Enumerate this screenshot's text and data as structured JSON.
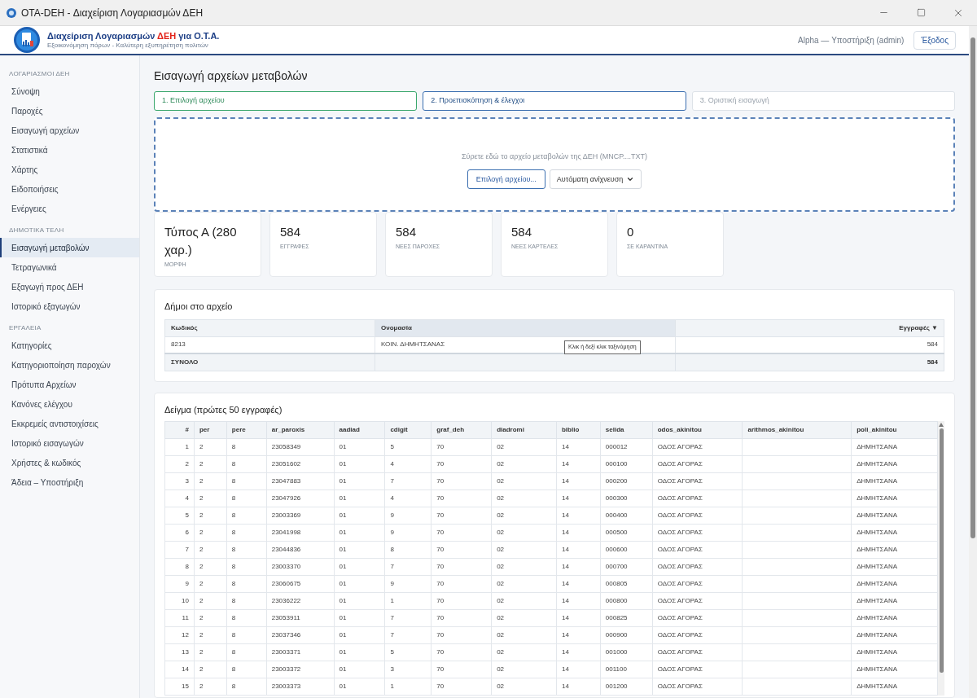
{
  "window": {
    "title": "OTA-DEH - Διαχείριση Λογαριασμών ΔΕΗ"
  },
  "header": {
    "brand_start": "Διαχείριση Λογαριασμών",
    "brand_accent": "ΔΕΗ",
    "brand_end": "για Ο.Τ.Α.",
    "tagline": "Εξοικονόμηση πόρων - Καλύτερη εξυπηρέτηση πολιτών",
    "user": "Alpha — Υποστήριξη (admin)",
    "logout": "Έξοδος"
  },
  "sidebar": [
    {
      "heading": "ΛΟΓΑΡΙΑΣΜΟΙ ΔΕΗ",
      "items": [
        {
          "label": "Σύνοψη",
          "selected": false
        },
        {
          "label": "Παροχές",
          "selected": false
        },
        {
          "label": "Εισαγωγή αρχείων",
          "selected": false
        },
        {
          "label": "Στατιστικά",
          "selected": false
        },
        {
          "label": "Χάρτης",
          "selected": false
        },
        {
          "label": "Ειδοποιήσεις",
          "selected": false
        },
        {
          "label": "Ενέργειες",
          "selected": false
        }
      ]
    },
    {
      "heading": "ΔΗΜΟΤΙΚΑ ΤΕΛΗ",
      "items": [
        {
          "label": "Εισαγωγή μεταβολών",
          "selected": true
        },
        {
          "label": "Τετραγωνικά",
          "selected": false
        },
        {
          "label": "Εξαγωγή προς ΔΕΗ",
          "selected": false
        },
        {
          "label": "Ιστορικό εξαγωγών",
          "selected": false
        }
      ]
    },
    {
      "heading": "ΕΡΓΑΛΕΙΑ",
      "items": [
        {
          "label": "Κατηγορίες",
          "selected": false
        },
        {
          "label": "Κατηγοριοποίηση παροχών",
          "selected": false
        },
        {
          "label": "Πρότυπα Αρχείων",
          "selected": false
        },
        {
          "label": "Κανόνες ελέγχου",
          "selected": false
        },
        {
          "label": "Εκκρεμείς αντιστοιχίσεις",
          "selected": false
        },
        {
          "label": "Ιστορικό εισαγωγών",
          "selected": false
        },
        {
          "label": "Χρήστες & κωδικός",
          "selected": false
        },
        {
          "label": "Άδεια – Υποστήριξη",
          "selected": false
        }
      ]
    }
  ],
  "page_title": "Εισαγωγή αρχείων μεταβολών",
  "steps": [
    {
      "label": "1. Επιλογή αρχείου",
      "kind": "done"
    },
    {
      "label": "2. Προεπισκόπηση & έλεγχοι",
      "kind": "active"
    },
    {
      "label": "3. Οριστική εισαγωγή",
      "kind": "pending"
    }
  ],
  "dropzone": {
    "hint": "Σύρετε εδώ το αρχείο μεταβολών της ΔΕΗ (MNCP....TXT)",
    "button": "Επιλογή αρχείου...",
    "format_select": "Αυτόματη ανίχνευση"
  },
  "stats": [
    {
      "value": "Τύπος Α (280 χαρ.)",
      "label": "ΜΟΡΦΗ"
    },
    {
      "value": "584",
      "label": "ΕΓΓΡΑΦΕΣ"
    },
    {
      "value": "584",
      "label": "ΝΕΕΣ ΠΑΡΟΧΕΣ"
    },
    {
      "value": "584",
      "label": "ΝΕΕΣ ΚΑΡΤΕΛΕΣ"
    },
    {
      "value": "0",
      "label": "ΣΕ ΚΑΡΑΝΤΙΝΑ"
    }
  ],
  "municipalities": {
    "title": "Δήμοι στο αρχείο",
    "columns": [
      {
        "label": "Κωδικός",
        "hovered": false
      },
      {
        "label": "Ονομασία",
        "hovered": true
      },
      {
        "label": "Εγγραφές",
        "hovered": false,
        "sort": "▼"
      }
    ],
    "rows": [
      [
        "8213",
        "ΚΟΙΝ. ΔΗΜΗΤΣΑΝΑΣ",
        "584"
      ]
    ],
    "total": {
      "label": "ΣΥΝΟΛΟ",
      "count": "584"
    },
    "tooltip": "Κλικ ή δεξί κλικ ταξινόμηση"
  },
  "sample": {
    "title": "Δείγμα (πρώτες 50 εγγραφές)",
    "columns": [
      "#",
      "per",
      "pere",
      "ar_paroxis",
      "aadiad",
      "cdigit",
      "graf_deh",
      "diadromi",
      "biblio",
      "selida",
      "odos_akinitou",
      "arithmos_akinitou",
      "poli_akinitou"
    ],
    "rows": [
      [
        "1",
        "2",
        "8",
        "23058349",
        "01",
        "5",
        "70",
        "02",
        "14",
        "000012",
        "ΟΔΟΣ ΑΓΟΡΑΣ",
        null,
        "ΔΗΜΗΤΣΑΝΑ"
      ],
      [
        "2",
        "2",
        "8",
        "23051602",
        "01",
        "4",
        "70",
        "02",
        "14",
        "000100",
        "ΟΔΟΣ ΑΓΟΡΑΣ",
        null,
        "ΔΗΜΗΤΣΑΝΑ"
      ],
      [
        "3",
        "2",
        "8",
        "23047883",
        "01",
        "7",
        "70",
        "02",
        "14",
        "000200",
        "ΟΔΟΣ ΑΓΟΡΑΣ",
        null,
        "ΔΗΜΗΤΣΑΝΑ"
      ],
      [
        "4",
        "2",
        "8",
        "23047926",
        "01",
        "4",
        "70",
        "02",
        "14",
        "000300",
        "ΟΔΟΣ ΑΓΟΡΑΣ",
        null,
        "ΔΗΜΗΤΣΑΝΑ"
      ],
      [
        "5",
        "2",
        "8",
        "23003369",
        "01",
        "9",
        "70",
        "02",
        "14",
        "000400",
        "ΟΔΟΣ ΑΓΟΡΑΣ",
        null,
        "ΔΗΜΗΤΣΑΝΑ"
      ],
      [
        "6",
        "2",
        "8",
        "23041998",
        "01",
        "9",
        "70",
        "02",
        "14",
        "000500",
        "ΟΔΟΣ ΑΓΟΡΑΣ",
        null,
        "ΔΗΜΗΤΣΑΝΑ"
      ],
      [
        "7",
        "2",
        "8",
        "23044836",
        "01",
        "8",
        "70",
        "02",
        "14",
        "000600",
        "ΟΔΟΣ ΑΓΟΡΑΣ",
        null,
        "ΔΗΜΗΤΣΑΝΑ"
      ],
      [
        "8",
        "2",
        "8",
        "23003370",
        "01",
        "7",
        "70",
        "02",
        "14",
        "000700",
        "ΟΔΟΣ ΑΓΟΡΑΣ",
        null,
        "ΔΗΜΗΤΣΑΝΑ"
      ],
      [
        "9",
        "2",
        "8",
        "23060675",
        "01",
        "9",
        "70",
        "02",
        "14",
        "000805",
        "ΟΔΟΣ ΑΓΟΡΑΣ",
        null,
        "ΔΗΜΗΤΣΑΝΑ"
      ],
      [
        "10",
        "2",
        "8",
        "23036222",
        "01",
        "1",
        "70",
        "02",
        "14",
        "000800",
        "ΟΔΟΣ ΑΓΟΡΑΣ",
        null,
        "ΔΗΜΗΤΣΑΝΑ"
      ],
      [
        "11",
        "2",
        "8",
        "23053911",
        "01",
        "7",
        "70",
        "02",
        "14",
        "000825",
        "ΟΔΟΣ ΑΓΟΡΑΣ",
        null,
        "ΔΗΜΗΤΣΑΝΑ"
      ],
      [
        "12",
        "2",
        "8",
        "23037346",
        "01",
        "7",
        "70",
        "02",
        "14",
        "000900",
        "ΟΔΟΣ ΑΓΟΡΑΣ",
        null,
        "ΔΗΜΗΤΣΑΝΑ"
      ],
      [
        "13",
        "2",
        "8",
        "23003371",
        "01",
        "5",
        "70",
        "02",
        "14",
        "001000",
        "ΟΔΟΣ ΑΓΟΡΑΣ",
        null,
        "ΔΗΜΗΤΣΑΝΑ"
      ],
      [
        "14",
        "2",
        "8",
        "23003372",
        "01",
        "3",
        "70",
        "02",
        "14",
        "001100",
        "ΟΔΟΣ ΑΓΟΡΑΣ",
        null,
        "ΔΗΜΗΤΣΑΝΑ"
      ],
      [
        "15",
        "2",
        "8",
        "23003373",
        "01",
        "1",
        "70",
        "02",
        "14",
        "001200",
        "ΟΔΟΣ ΑΓΟΡΑΣ",
        null,
        "ΔΗΜΗΤΣΑΝΑ"
      ]
    ]
  }
}
